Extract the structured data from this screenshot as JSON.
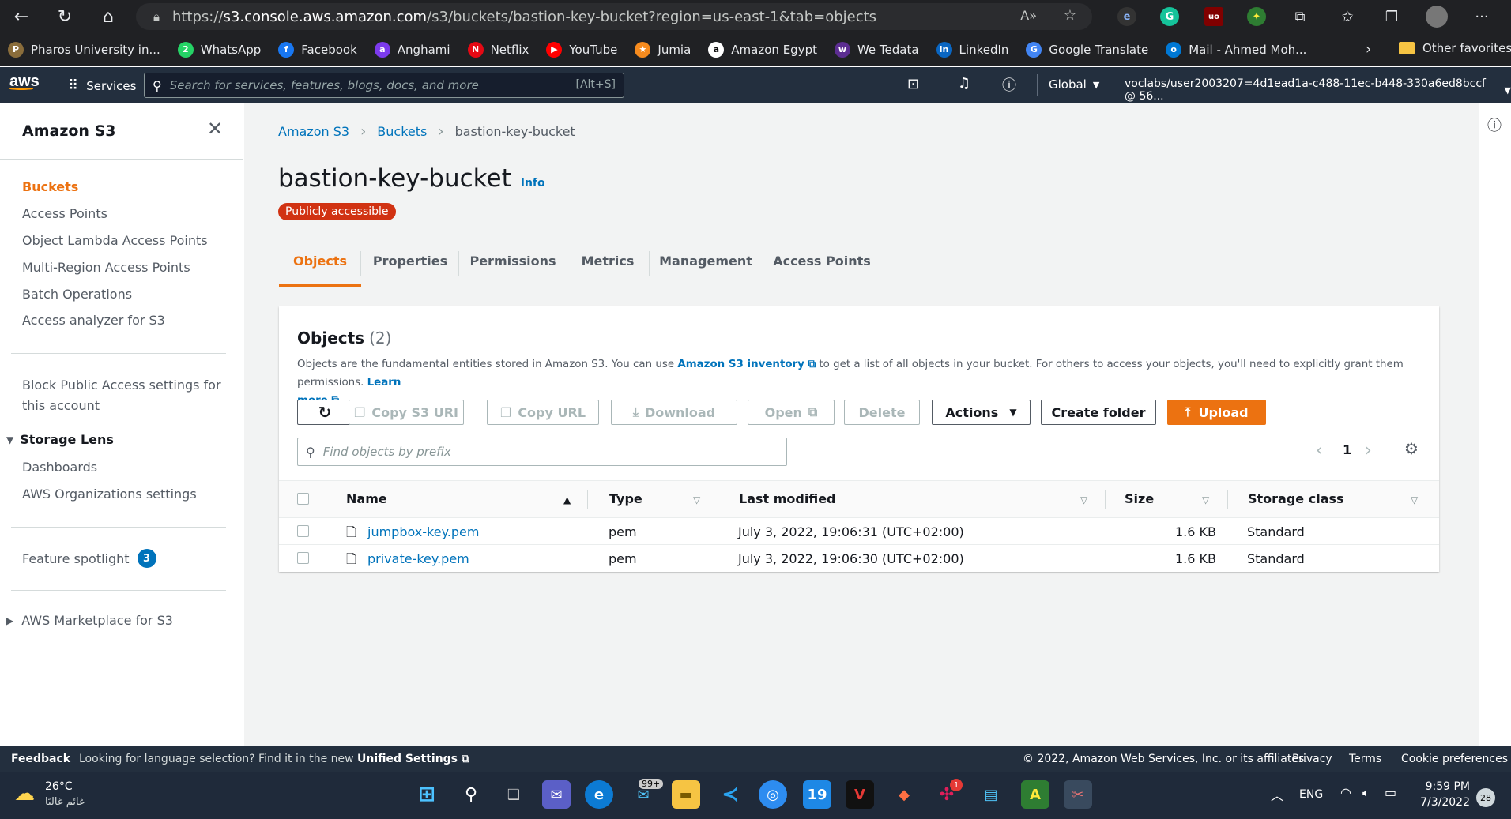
{
  "browser": {
    "url_prefix": "https://",
    "url_host": "s3.console.aws.amazon.com",
    "url_path": "/s3/buckets/bastion-key-bucket?region=us-east-1&tab=objects",
    "bookmarks": [
      {
        "label": "Pharos University in...",
        "color": "#8a6d3b",
        "glyph": "P"
      },
      {
        "label": "WhatsApp",
        "color": "#25d366",
        "glyph": "2"
      },
      {
        "label": "Facebook",
        "color": "#1877f2",
        "glyph": "f"
      },
      {
        "label": "Anghami",
        "color": "#7c3aed",
        "glyph": "a"
      },
      {
        "label": "Netflix",
        "color": "#e50914",
        "glyph": "N"
      },
      {
        "label": "YouTube",
        "color": "#ff0000",
        "glyph": "▶"
      },
      {
        "label": "Jumia",
        "color": "#f68b1e",
        "glyph": "★"
      },
      {
        "label": "Amazon Egypt",
        "color": "#ffffff",
        "glyph": "a"
      },
      {
        "label": "We Tedata",
        "color": "#5c2d91",
        "glyph": "w"
      },
      {
        "label": "LinkedIn",
        "color": "#0a66c2",
        "glyph": "in"
      },
      {
        "label": "Google Translate",
        "color": "#4285f4",
        "glyph": "G"
      },
      {
        "label": "Mail - Ahmed Moh...",
        "color": "#0078d4",
        "glyph": "o"
      }
    ],
    "other_favorites": "Other favorites"
  },
  "aws_header": {
    "logo": "aws",
    "services": "Services",
    "search_placeholder": "Search for services, features, blogs, docs, and more",
    "search_shortcut": "[Alt+S]",
    "region": "Global",
    "account": "voclabs/user2003207=4d1ead1a-c488-11ec-b448-330a6ed8bccf @ 56..."
  },
  "sidebar": {
    "title": "Amazon S3",
    "items": [
      "Buckets",
      "Access Points",
      "Object Lambda Access Points",
      "Multi-Region Access Points",
      "Batch Operations",
      "Access analyzer for S3"
    ],
    "block_public_line1": "Block Public Access settings for",
    "block_public_line2": "this account",
    "storage_lens": "Storage Lens",
    "storage_lens_items": [
      "Dashboards",
      "AWS Organizations settings"
    ],
    "feature_spotlight": "Feature spotlight",
    "feature_spotlight_count": "3",
    "marketplace": "AWS Marketplace for S3"
  },
  "breadcrumb": [
    "Amazon S3",
    "Buckets",
    "bastion-key-bucket"
  ],
  "bucket": {
    "name": "bastion-key-bucket",
    "info": "Info",
    "badge": "Publicly accessible",
    "badge_color": "#d13212"
  },
  "tabs": [
    "Objects",
    "Properties",
    "Permissions",
    "Metrics",
    "Management",
    "Access Points"
  ],
  "objects_panel": {
    "title": "Objects",
    "count": "(2)",
    "desc_part1": "Objects are the fundamental entities stored in Amazon S3. You can use ",
    "desc_link1": "Amazon S3 inventory",
    "desc_part2": " to get a list of all objects in your bucket. For others to access your objects, you'll need to explicitly grant them permissions. ",
    "desc_link2a": "Learn",
    "desc_link2b": "more",
    "buttons": {
      "copy_s3_uri": "Copy S3 URI",
      "copy_url": "Copy URL",
      "download": "Download",
      "open": "Open",
      "delete": "Delete",
      "actions": "Actions",
      "create_folder": "Create folder",
      "upload": "Upload"
    },
    "filter_placeholder": "Find objects by prefix",
    "page": "1",
    "columns": [
      "Name",
      "Type",
      "Last modified",
      "Size",
      "Storage class"
    ],
    "rows": [
      {
        "name": "jumpbox-key.pem",
        "type": "pem",
        "modified": "July 3, 2022, 19:06:31 (UTC+02:00)",
        "size": "1.6 KB",
        "storage": "Standard"
      },
      {
        "name": "private-key.pem",
        "type": "pem",
        "modified": "July 3, 2022, 19:06:30 (UTC+02:00)",
        "size": "1.6 KB",
        "storage": "Standard"
      }
    ]
  },
  "footer": {
    "feedback": "Feedback",
    "lang_text": "Looking for language selection? Find it in the new ",
    "lang_link": "Unified Settings",
    "copyright": "© 2022, Amazon Web Services, Inc. or its affiliates.",
    "privacy": "Privacy",
    "terms": "Terms",
    "cookies": "Cookie preferences"
  },
  "taskbar": {
    "temp": "26°C",
    "weather": "غائم غالبًا",
    "lang": "ENG",
    "time": "9:59 PM",
    "date": "7/3/2022",
    "notif_count": "28",
    "mail_badge": "99+",
    "slack_badge": "1"
  },
  "colors": {
    "accent": "#ec7211",
    "link": "#0073bb",
    "header": "#232f3e"
  }
}
